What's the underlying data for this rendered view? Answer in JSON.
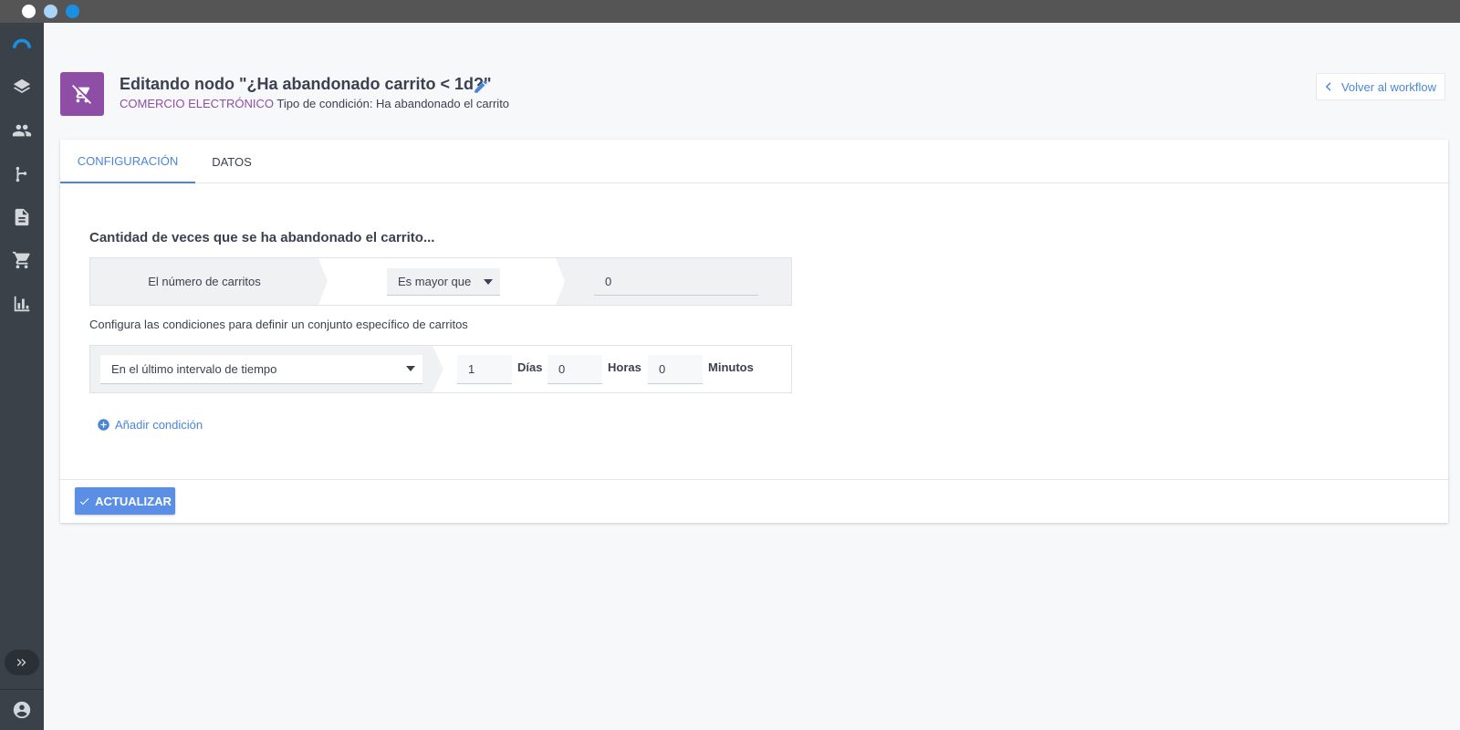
{
  "colors": {
    "accent": "#4a86d8",
    "category": "#8e4ea6",
    "sidebar": "#3a4148",
    "primary_button": "#5b8fe6"
  },
  "window": {
    "controls": [
      "window-close",
      "window-minimize",
      "window-maximize"
    ]
  },
  "sidebar": {
    "items": [
      {
        "name": "logo",
        "icon": "arc-logo-icon"
      },
      {
        "name": "layers",
        "icon": "layers-icon"
      },
      {
        "name": "contacts",
        "icon": "people-icon"
      },
      {
        "name": "workflows",
        "icon": "branch-icon"
      },
      {
        "name": "documents",
        "icon": "document-icon"
      },
      {
        "name": "ecommerce",
        "icon": "cart-icon"
      },
      {
        "name": "reports",
        "icon": "bar-chart-icon"
      }
    ],
    "expand_icon": "double-chevron-right-icon",
    "user_icon": "account-circle-icon"
  },
  "header": {
    "badge_icon": "cart-off-icon",
    "title": "Editando nodo \"¿Ha abandonado carrito < 1d?\"",
    "edit_icon": "pencil-icon",
    "category": "COMERCIO ELECTRÓNICO",
    "condition_type": "Tipo de condición: Ha abandonado el carrito",
    "back_label": "Volver al workflow"
  },
  "tabs": [
    {
      "label": "CONFIGURACIÓN",
      "active": true
    },
    {
      "label": "DATOS",
      "active": false
    }
  ],
  "form": {
    "section_title": "Cantidad de veces que se ha abandonado el carrito...",
    "count_label": "El número de carritos",
    "operator_selected": "Es mayor que",
    "count_value": "0",
    "hint": "Configura las condiciones para definir un conjunto específico de carritos",
    "interval_selected": "En el último intervalo de tiempo",
    "days_value": "1",
    "days_label": "Días",
    "hours_value": "0",
    "hours_label": "Horas",
    "minutes_value": "0",
    "minutes_label": "Minutos",
    "add_condition": "Añadir condición"
  },
  "footer": {
    "update_label": "ACTUALIZAR"
  }
}
